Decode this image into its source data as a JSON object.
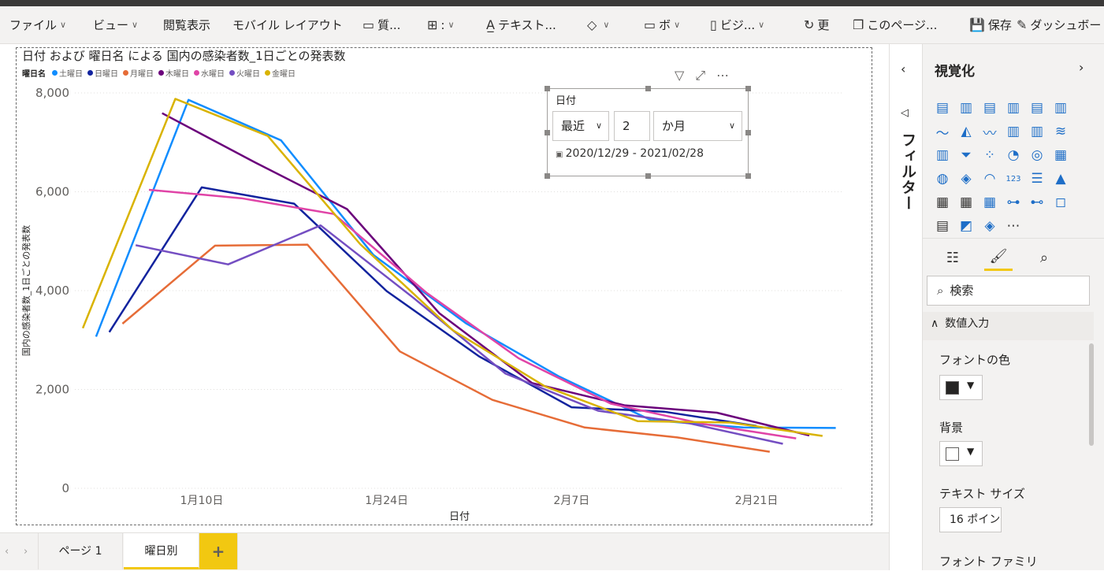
{
  "ribbon": {
    "items": [
      {
        "label": "ファイル",
        "chev": "∨"
      },
      {
        "label": "ビュー",
        "chev": "∨"
      },
      {
        "label": "閲覧表示",
        "chev": ""
      },
      {
        "label": "モバイル レイアウト",
        "chev": ""
      },
      {
        "label": "質...",
        "chev": ""
      },
      {
        "label": ":",
        "chev": "∨"
      },
      {
        "label": "テキスト...",
        "chev": ""
      },
      {
        "label": "",
        "chev": "∨"
      },
      {
        "label": "ボ",
        "chev": "∨"
      },
      {
        "label": "ビジ...",
        "chev": "∨"
      },
      {
        "label": "更",
        "chev": ""
      },
      {
        "label": "このページ...",
        "chev": ""
      },
      {
        "label": "保存",
        "chev": ""
      },
      {
        "label": "ダッシュボード",
        "chev": ""
      }
    ]
  },
  "chart": {
    "title": "日付 および 曜日名 による 国内の感染者数_1日ごとの発表数",
    "legend_title": "曜日名"
  },
  "chart_data": {
    "type": "line",
    "title": "日付 および 曜日名 による 国内の感染者数_1日ごとの発表数",
    "xlabel": "日付",
    "ylabel": "国内の感染者数_1日ごとの発表数",
    "ylim": [
      0,
      8000
    ],
    "yticks": [
      "0",
      "2,000",
      "4,000",
      "6,000",
      "8,000"
    ],
    "xticks": [
      {
        "date": "2021-01-10",
        "label": "1月10日"
      },
      {
        "date": "2021-01-24",
        "label": "1月24日"
      },
      {
        "date": "2021-02-07",
        "label": "2月7日"
      },
      {
        "date": "2021-02-21",
        "label": "2月21日"
      }
    ],
    "xlim": [
      "2020-12-29",
      "2021-02-28"
    ],
    "grid": true,
    "legend_position": "top-left",
    "series": [
      {
        "name": "土曜日",
        "color": "#118dff",
        "points": [
          [
            "2021-01-02",
            3070
          ],
          [
            "2021-01-09",
            7860
          ],
          [
            "2021-01-16",
            7040
          ],
          [
            "2021-01-23",
            4720
          ],
          [
            "2021-01-30",
            3340
          ],
          [
            "2021-02-06",
            2270
          ],
          [
            "2021-02-13",
            1380
          ],
          [
            "2021-02-20",
            1230
          ],
          [
            "2021-02-27",
            1220
          ]
        ]
      },
      {
        "name": "日曜日",
        "color": "#12239e",
        "points": [
          [
            "2021-01-03",
            3160
          ],
          [
            "2021-01-10",
            6090
          ],
          [
            "2021-01-17",
            5760
          ],
          [
            "2021-01-24",
            3990
          ],
          [
            "2021-01-31",
            2670
          ],
          [
            "2021-02-07",
            1640
          ],
          [
            "2021-02-14",
            1550
          ],
          [
            "2021-02-21",
            1260
          ]
        ]
      },
      {
        "name": "月曜日",
        "color": "#e66c37",
        "points": [
          [
            "2021-01-04",
            3330
          ],
          [
            "2021-01-11",
            4910
          ],
          [
            "2021-01-18",
            4930
          ],
          [
            "2021-01-25",
            2770
          ],
          [
            "2021-02-01",
            1790
          ],
          [
            "2021-02-08",
            1230
          ],
          [
            "2021-02-15",
            1030
          ],
          [
            "2021-02-22",
            740
          ]
        ]
      },
      {
        "name": "木曜日",
        "color": "#6b007b",
        "points": [
          [
            "2021-01-07",
            7590
          ],
          [
            "2021-01-14",
            6600
          ],
          [
            "2021-01-21",
            5650
          ],
          [
            "2021-01-28",
            3540
          ],
          [
            "2021-02-04",
            2130
          ],
          [
            "2021-02-11",
            1680
          ],
          [
            "2021-02-18",
            1530
          ],
          [
            "2021-02-25",
            1070
          ]
        ]
      },
      {
        "name": "水曜日",
        "color": "#e044a7",
        "points": [
          [
            "2021-01-06",
            6040
          ],
          [
            "2021-01-13",
            5870
          ],
          [
            "2021-01-20",
            5550
          ],
          [
            "2021-01-27",
            3960
          ],
          [
            "2021-02-03",
            2630
          ],
          [
            "2021-02-10",
            1710
          ],
          [
            "2021-02-17",
            1300
          ],
          [
            "2021-02-24",
            1010
          ]
        ]
      },
      {
        "name": "火曜日",
        "color": "#744ec2",
        "points": [
          [
            "2021-01-05",
            4920
          ],
          [
            "2021-01-12",
            4530
          ],
          [
            "2021-01-19",
            5320
          ],
          [
            "2021-01-26",
            3860
          ],
          [
            "2021-02-02",
            2320
          ],
          [
            "2021-02-09",
            1570
          ],
          [
            "2021-02-16",
            1310
          ],
          [
            "2021-02-23",
            900
          ]
        ]
      },
      {
        "name": "金曜日",
        "color": "#d9b300",
        "points": [
          [
            "2021-01-01",
            3240
          ],
          [
            "2021-01-08",
            7880
          ],
          [
            "2021-01-15",
            7130
          ],
          [
            "2021-01-22",
            4940
          ],
          [
            "2021-01-29",
            3200
          ],
          [
            "2021-02-05",
            2060
          ],
          [
            "2021-02-12",
            1360
          ],
          [
            "2021-02-19",
            1330
          ],
          [
            "2021-02-26",
            1060
          ]
        ]
      }
    ]
  },
  "slicer": {
    "title": "日付",
    "mode": "最近",
    "count": "2",
    "unit": "か月",
    "range": "2020/12/29 - 2021/02/28",
    "chev": "∨"
  },
  "visual_header_icons": [
    "▽",
    "⤢",
    "⋯"
  ],
  "tabs": {
    "nav_prev": "‹",
    "nav_next": "›",
    "pages": [
      "ページ 1",
      "曜日別"
    ],
    "add": "+"
  },
  "filter_pane": {
    "collapse": "‹",
    "icon": "◁",
    "label": "フィルター"
  },
  "viz_pane": {
    "title": "視覚化",
    "expand": "›",
    "viz_icons": [
      "▤",
      "▥",
      "▤",
      "▥",
      "▤",
      "▥",
      "〜",
      "◭",
      "〰",
      "▥",
      "▥",
      "≋",
      "▥",
      "⏷",
      "⁘",
      "◔",
      "◎",
      "▦",
      "◍",
      "◈",
      "◠",
      "123",
      "☰",
      "▲",
      "▦",
      "▦",
      "▦",
      "⊶",
      "⊷",
      "◻",
      "▤",
      "◩",
      "◈",
      "⋯"
    ],
    "subtabs": [
      "☷",
      "🖌",
      "⌕"
    ],
    "search_icon": "⌕",
    "search_placeholder": "検索",
    "section_icon": "∧",
    "section": "数値入力",
    "font_color_label": "フォントの色",
    "font_color": "#252423",
    "bg_label": "背景",
    "bg_color": "#ffffff",
    "dropdown_arrow": "▼",
    "text_size_label": "テキスト サイズ",
    "text_size_value": "16",
    "text_size_unit": "ポイント",
    "font_family_label": "フォント ファミリ"
  }
}
